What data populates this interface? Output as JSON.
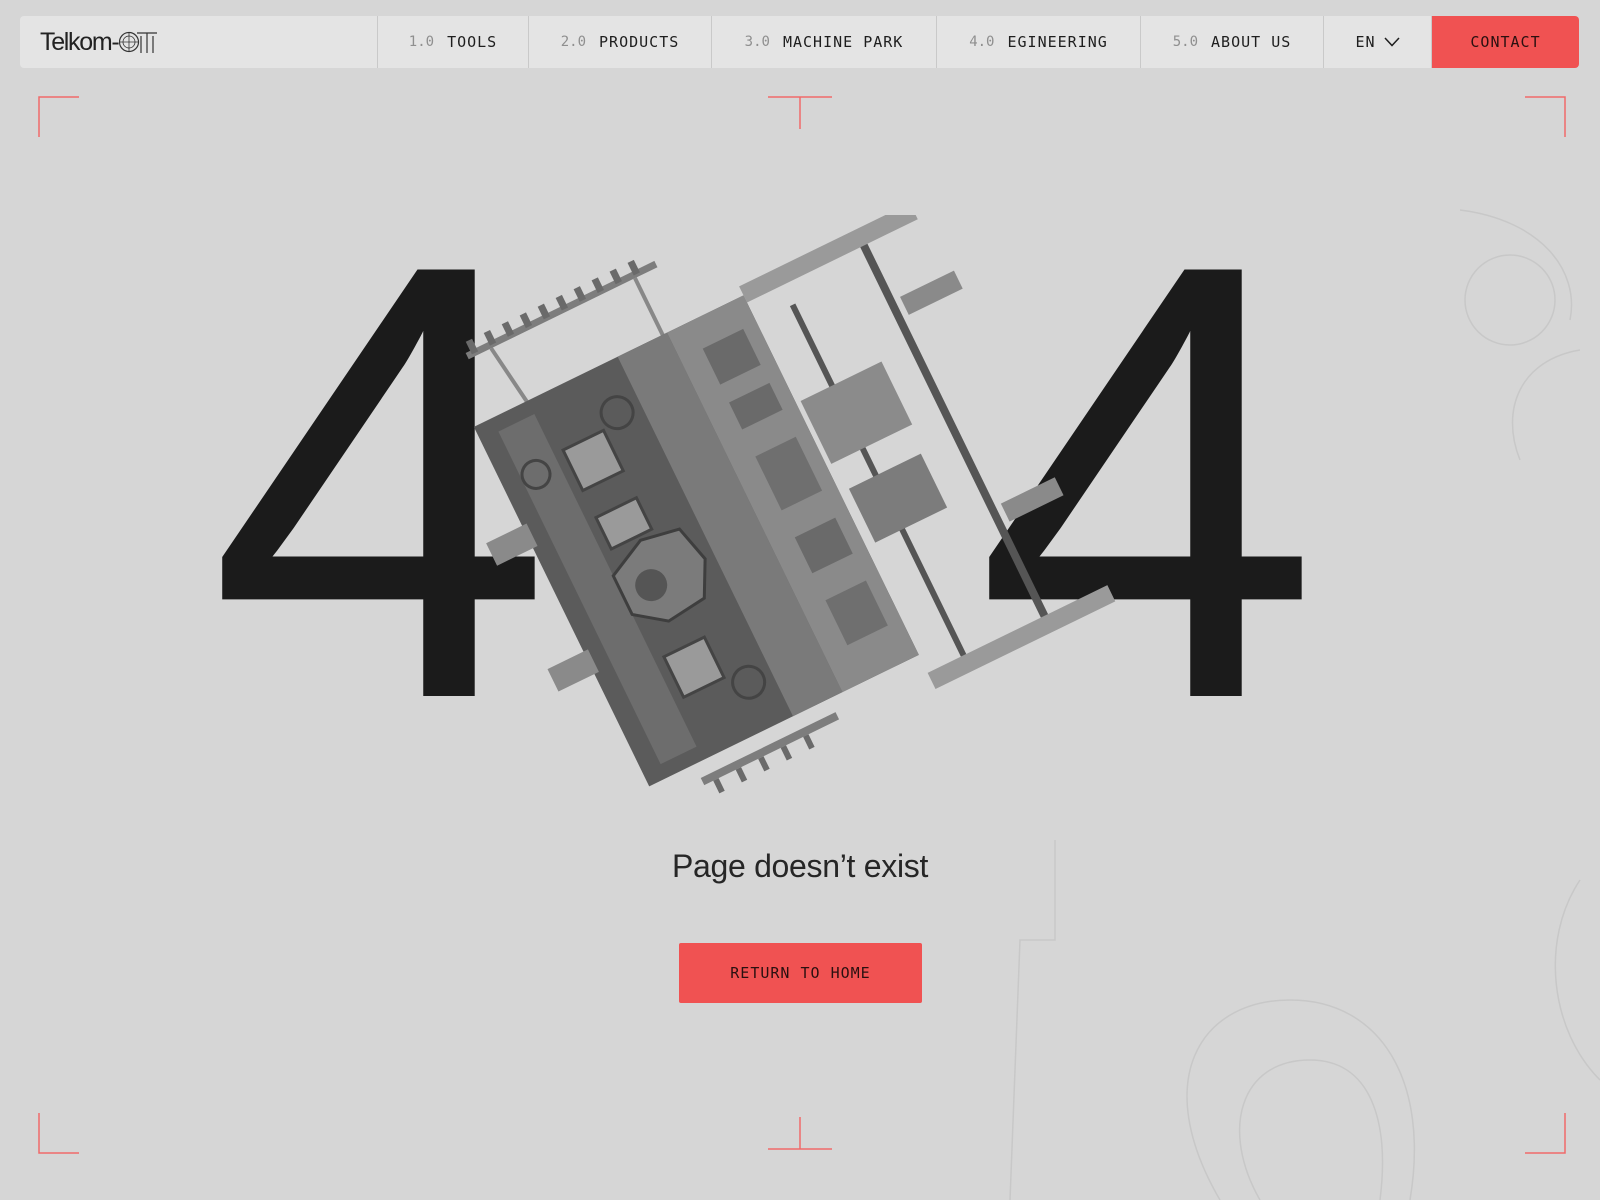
{
  "nav": {
    "logo_text": "Telkom-",
    "logo_mark_text": "OT",
    "items": [
      {
        "num": "1.0",
        "label": "TOOLS"
      },
      {
        "num": "2.0",
        "label": "PRODUCTS"
      },
      {
        "num": "3.0",
        "label": "MACHINE PARK"
      },
      {
        "num": "4.0",
        "label": "EGINEERING"
      },
      {
        "num": "5.0",
        "label": "ABOUT US"
      }
    ],
    "language": "EN",
    "contact_label": "CONTACT"
  },
  "hero": {
    "digit_left": "4",
    "digit_right": "4",
    "message": "Page doesn’t exist",
    "return_label": "RETURN TO HOME"
  },
  "icons": [
    "chevron-down-icon",
    "mould-machine-illustration",
    "corner-frame-mark"
  ],
  "colors": {
    "accent": "#f05252",
    "background": "#d6d6d6",
    "nav_background": "#e4e4e4",
    "text": "#1b1b1b"
  }
}
